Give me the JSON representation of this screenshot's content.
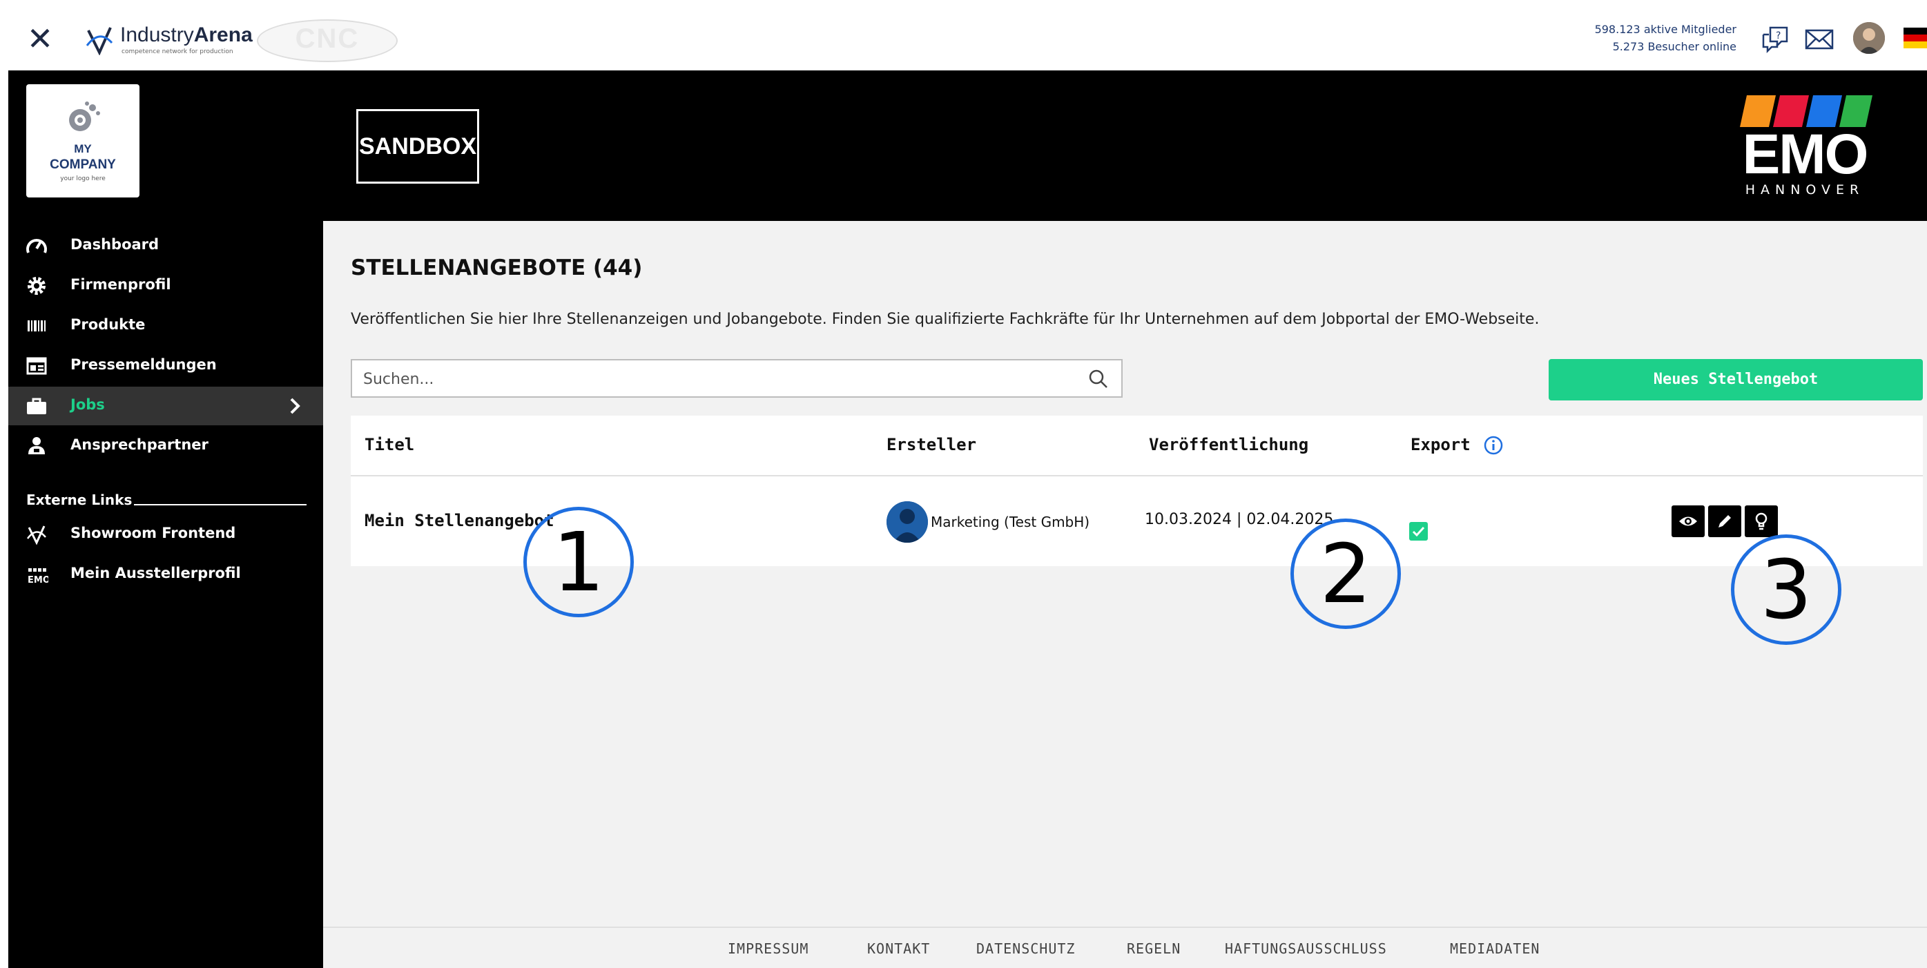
{
  "topbar": {
    "close_icon": "close-icon",
    "brand_prefix": "Industry",
    "brand_suffix": "Arena",
    "brand_tagline": "competence network for production",
    "partner_logo": "CNC",
    "stats_members": "598.123 aktive Mitglieder",
    "stats_online": "5.273 Besucher online",
    "icons": [
      "chat-help-icon",
      "mail-icon",
      "user-avatar",
      "german-flag-icon"
    ]
  },
  "sidebar": {
    "company_logo": {
      "line1": "MY",
      "line2": "COMPANY",
      "line3": "your logo here"
    },
    "items": [
      {
        "label": "Dashboard",
        "icon": "speedometer-icon"
      },
      {
        "label": "Firmenprofil",
        "icon": "gear-icon"
      },
      {
        "label": "Produkte",
        "icon": "barcode-icon"
      },
      {
        "label": "Pressemeldungen",
        "icon": "newspaper-icon"
      },
      {
        "label": "Jobs",
        "icon": "briefcase-icon",
        "active": true
      },
      {
        "label": "Ansprechpartner",
        "icon": "contact-person-icon"
      }
    ],
    "external_heading": "Externe Links",
    "external_links": [
      {
        "label": "Showroom Frontend",
        "icon": "industryarena-icon"
      },
      {
        "label": "Mein Ausstellerprofil",
        "icon": "emo-icon"
      }
    ]
  },
  "header": {
    "sandbox_label": "SANDBOX",
    "emo_logo": {
      "word": "EMO",
      "city": "HANNOVER",
      "stripe_colors": [
        "#f7941d",
        "#e8193c",
        "#1c75e8",
        "#2db34a"
      ]
    }
  },
  "main": {
    "title": "STELLENANGEBOTE (44)",
    "intro": "Veröffentlichen Sie hier Ihre Stellenanzeigen und Jobangebote. Finden Sie qualifizierte Fachkräfte für Ihr Unternehmen auf dem Jobportal der EMO-Webseite.",
    "search_placeholder": "Suchen...",
    "new_button": "Neues Stellengebot",
    "columns": [
      "Titel",
      "Ersteller",
      "Veröffentlichung",
      "Export"
    ],
    "rows": [
      {
        "title": "Mein Stellenangebot",
        "creator": "Marketing (Test GmbH)",
        "dates": "10.03.2024 | 02.04.2025",
        "export": true,
        "actions": [
          "eye-icon",
          "pencil-icon",
          "lightbulb-icon"
        ]
      }
    ]
  },
  "footer": {
    "links": [
      "IMPRESSUM",
      "KONTAKT",
      "DATENSCHUTZ",
      "REGELN",
      "HAFTUNGSAUSSCHLUSS",
      "MEDIADATEN"
    ]
  },
  "annotations": [
    "1",
    "2",
    "3"
  ],
  "colors": {
    "accent_green": "#1dd08a",
    "marker_blue": "#1f6fe0",
    "brand_navy": "#1f3a70"
  }
}
